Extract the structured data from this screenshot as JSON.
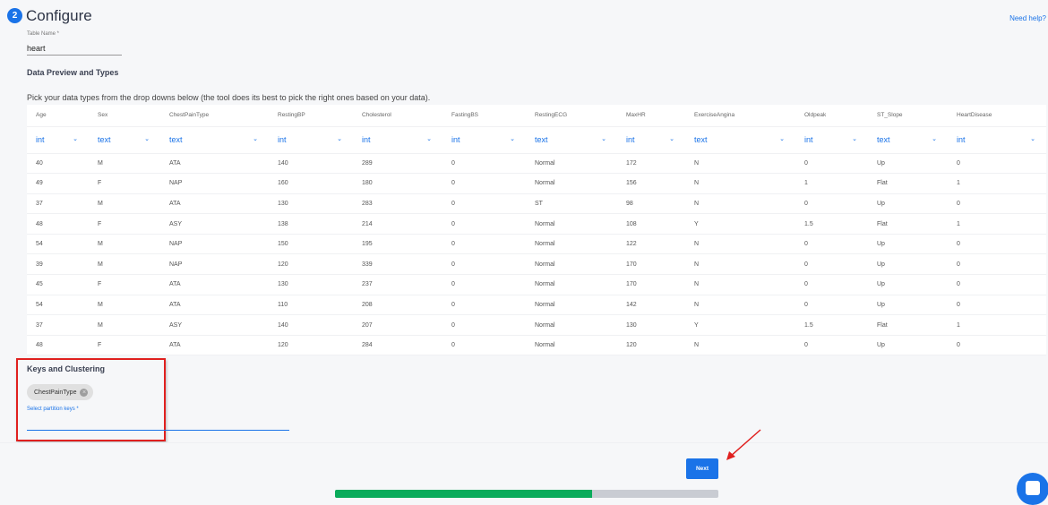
{
  "header": {
    "step": "2",
    "title": "Configure",
    "help": "Need help?"
  },
  "table_name": {
    "label": "Table Name *",
    "value": "heart"
  },
  "preview": {
    "heading": "Data Preview and Types",
    "description": "Pick your data types from the drop downs below (the tool does its best to pick the right ones based on your data)."
  },
  "columns": [
    "Age",
    "Sex",
    "ChestPainType",
    "RestingBP",
    "Cholesterol",
    "FastingBS",
    "RestingECG",
    "MaxHR",
    "ExerciseAngina",
    "Oldpeak",
    "ST_Slope",
    "HeartDisease"
  ],
  "types": [
    "int",
    "text",
    "text",
    "int",
    "int",
    "int",
    "text",
    "int",
    "text",
    "int",
    "text",
    "int"
  ],
  "rows": [
    [
      "40",
      "M",
      "ATA",
      "140",
      "289",
      "0",
      "Normal",
      "172",
      "N",
      "0",
      "Up",
      "0"
    ],
    [
      "49",
      "F",
      "NAP",
      "160",
      "180",
      "0",
      "Normal",
      "156",
      "N",
      "1",
      "Flat",
      "1"
    ],
    [
      "37",
      "M",
      "ATA",
      "130",
      "283",
      "0",
      "ST",
      "98",
      "N",
      "0",
      "Up",
      "0"
    ],
    [
      "48",
      "F",
      "ASY",
      "138",
      "214",
      "0",
      "Normal",
      "108",
      "Y",
      "1.5",
      "Flat",
      "1"
    ],
    [
      "54",
      "M",
      "NAP",
      "150",
      "195",
      "0",
      "Normal",
      "122",
      "N",
      "0",
      "Up",
      "0"
    ],
    [
      "39",
      "M",
      "NAP",
      "120",
      "339",
      "0",
      "Normal",
      "170",
      "N",
      "0",
      "Up",
      "0"
    ],
    [
      "45",
      "F",
      "ATA",
      "130",
      "237",
      "0",
      "Normal",
      "170",
      "N",
      "0",
      "Up",
      "0"
    ],
    [
      "54",
      "M",
      "ATA",
      "110",
      "208",
      "0",
      "Normal",
      "142",
      "N",
      "0",
      "Up",
      "0"
    ],
    [
      "37",
      "M",
      "ASY",
      "140",
      "207",
      "0",
      "Normal",
      "130",
      "Y",
      "1.5",
      "Flat",
      "1"
    ],
    [
      "48",
      "F",
      "ATA",
      "120",
      "284",
      "0",
      "Normal",
      "120",
      "N",
      "0",
      "Up",
      "0"
    ]
  ],
  "keys": {
    "heading": "Keys and Clustering",
    "chips": [
      "ChestPainType"
    ],
    "label": "Select partition keys *"
  },
  "footer": {
    "next": "Next",
    "progress_percent": 67
  },
  "colors": {
    "accent": "#1a73e8",
    "progress": "#0aab5b",
    "highlight": "#e0201f"
  }
}
